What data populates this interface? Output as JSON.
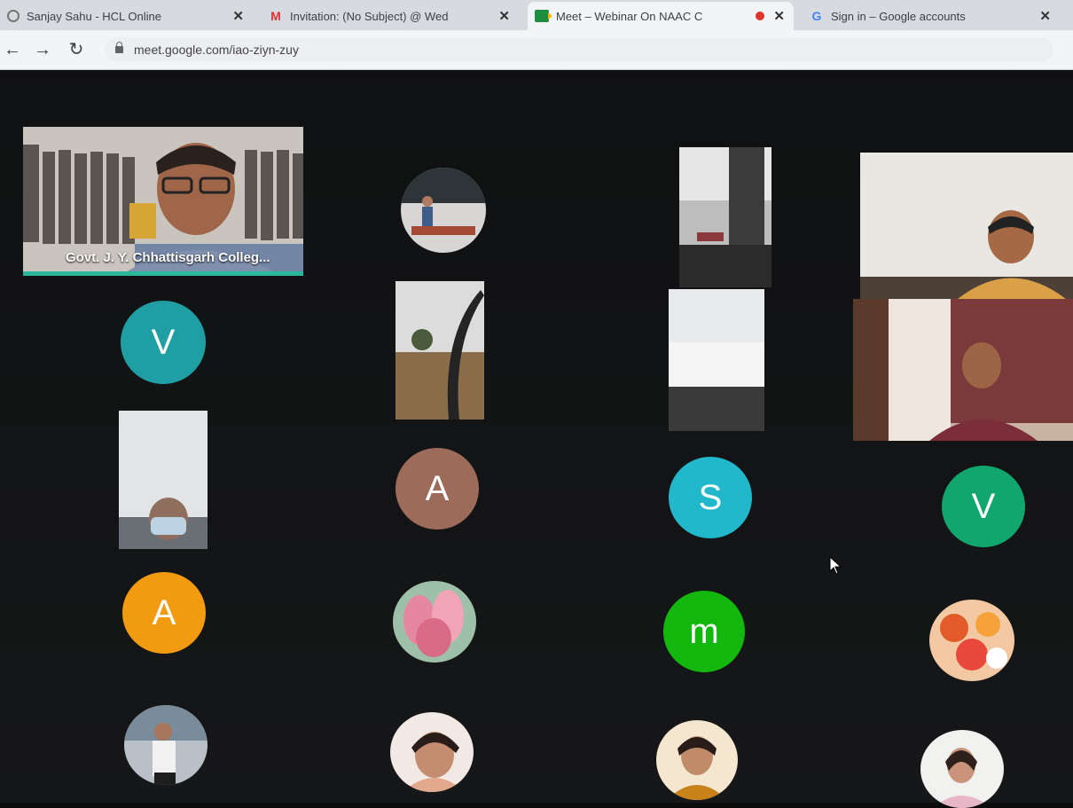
{
  "browser": {
    "tabs": [
      {
        "label": "Sanjay Sahu - HCL Online",
        "icon": "tab-page-icon"
      },
      {
        "label": "Invitation: (No Subject) @ Wed",
        "icon": "gmail-icon"
      },
      {
        "label": "Meet – Webinar On NAAC C",
        "icon": "meet-icon",
        "active": true
      },
      {
        "label": "Sign in – Google accounts",
        "icon": "google-icon"
      }
    ],
    "url": "meet.google.com/iao-ziyn-zuy"
  },
  "meet": {
    "presenter_name": "Govt. J. Y. Chhattisgarh Colleg...",
    "avatars": [
      {
        "letter": "V",
        "color": "#1f9fa3"
      },
      {
        "letter": "A",
        "color": "#9c6b5a"
      },
      {
        "letter": "S",
        "color": "#22b8cc"
      },
      {
        "letter": "V",
        "color": "#10a66e"
      },
      {
        "letter": "A",
        "color": "#f29b10"
      },
      {
        "letter": "m",
        "color": "#13b80f"
      }
    ]
  }
}
